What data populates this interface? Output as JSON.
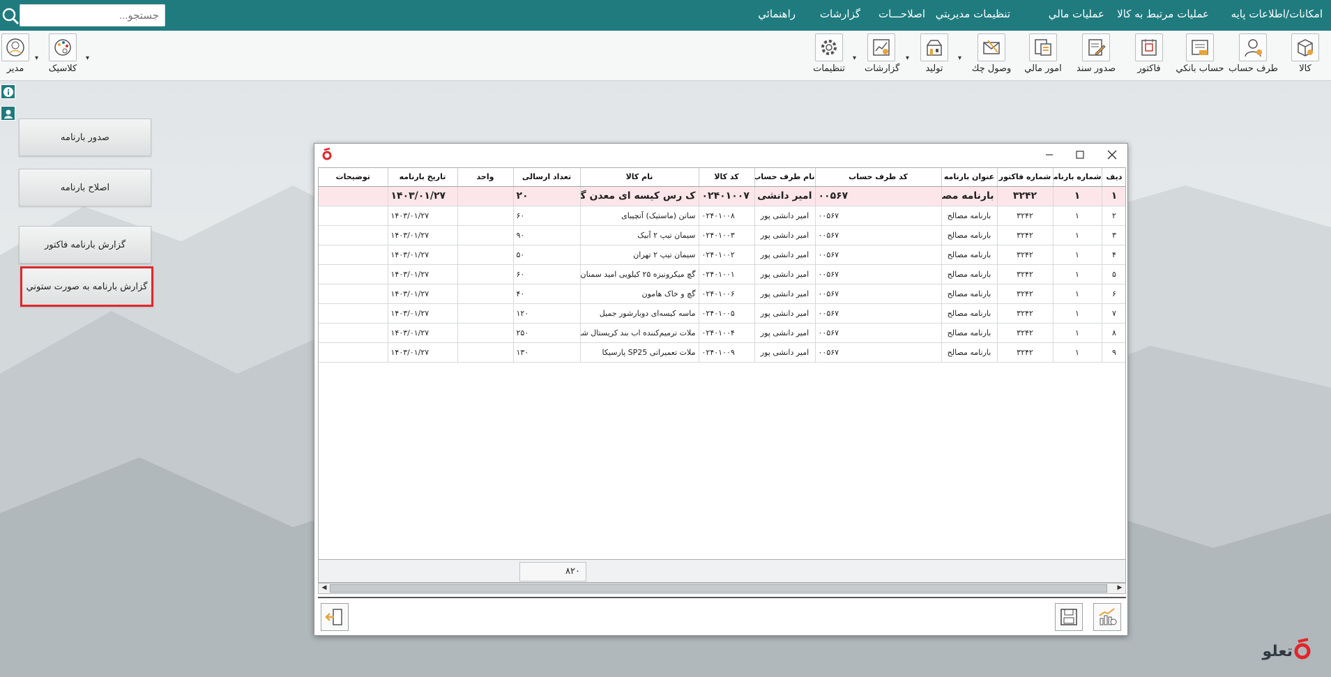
{
  "menu": {
    "items": [
      "امکانات/اطلاعات پايه",
      "عمليات مرتبط به کالا",
      "عمليات مالي",
      "تنظيمات مديريتي",
      "اصلاحـــات",
      "گزارشات",
      "راهنمائي"
    ]
  },
  "search": {
    "placeholder": "جستجو..."
  },
  "toolbar": {
    "items": [
      "کالا",
      "طرف حساب",
      "حساب بانکي",
      "فاکتور",
      "صدور سند",
      "امور مالي",
      "وصول چك",
      "توليد",
      "گزارشات",
      "تنظيمات"
    ],
    "right_items": [
      "کلاسيک",
      "مدير"
    ]
  },
  "left_buttons": [
    "صدور بارنامه",
    "اصلاح بارنامه",
    "گزارش بارنامه فاکتور",
    "گزارش بارنامه به صورت ستوني"
  ],
  "table": {
    "headers": [
      "ديف",
      "شماره بارنامه",
      "شماره فاکتور",
      "عنوان بارنامه",
      "کد طرف حساب",
      "نام طرف حساب",
      "کد کالا",
      "نام کالا",
      "تعداد ارسالی",
      "واحد",
      "تاريخ بارنامه",
      "توضيحات"
    ],
    "rows": [
      [
        "۱",
        "۱",
        "۳۲۴۲",
        "بارنامه مصالح",
        "۰۰۵۶۷",
        "امیر دانشی پور",
        "۰۲۴۰۱۰۰۷",
        "ک رس کیسه ای معدن گودرزی",
        "۲۰",
        "",
        "۱۴۰۳/۰۱/۲۷",
        ""
      ],
      [
        "۲",
        "۱",
        "۳۲۴۲",
        "بارنامه مصالح",
        "۰۰۵۶۷",
        "امیر دانشی پور",
        "۰۲۴۰۱۰۰۸",
        "ساتن (ماستیک) آتچیبای",
        "۶۰",
        "",
        "۱۴۰۳/۰۱/۲۷",
        ""
      ],
      [
        "۳",
        "۱",
        "۳۲۴۲",
        "بارنامه مصالح",
        "۰۰۵۶۷",
        "امیر دانشی پور",
        "۰۲۴۰۱۰۰۳",
        "سیمان تیپ ۲ آبیک",
        "۹۰",
        "",
        "۱۴۰۳/۰۱/۲۷",
        ""
      ],
      [
        "۴",
        "۱",
        "۳۲۴۲",
        "بارنامه مصالح",
        "۰۰۵۶۷",
        "امیر دانشی پور",
        "۰۲۴۰۱۰۰۲",
        "سیمان تیپ ۲ تهران",
        "۵۰",
        "",
        "۱۴۰۳/۰۱/۲۷",
        ""
      ],
      [
        "۵",
        "۱",
        "۳۲۴۲",
        "بارنامه مصالح",
        "۰۰۵۶۷",
        "امیر دانشی پور",
        "۰۲۴۰۱۰۰۱",
        "گچ میکرونیزه ۲۵ کیلویی امید سمنان",
        "۶۰",
        "",
        "۱۴۰۳/۰۱/۲۷",
        ""
      ],
      [
        "۶",
        "۱",
        "۳۲۴۲",
        "بارنامه مصالح",
        "۰۰۵۶۷",
        "امیر دانشی پور",
        "۰۲۴۰۱۰۰۶",
        "گچ و خاک هامون",
        "۴۰",
        "",
        "۱۴۰۳/۰۱/۲۷",
        ""
      ],
      [
        "۷",
        "۱",
        "۳۲۴۲",
        "بارنامه مصالح",
        "۰۰۵۶۷",
        "امیر دانشی پور",
        "۰۲۴۰۱۰۰۵",
        "ماسه کیسه‌ای دوبارشور جمیل",
        "۱۲۰",
        "",
        "۱۴۰۳/۰۱/۲۷",
        ""
      ],
      [
        "۸",
        "۱",
        "۳۲۴۲",
        "بارنامه مصالح",
        "۰۰۵۶۷",
        "امیر دانشی پور",
        "۰۲۴۰۱۰۰۴",
        "ملات ترمیم‌کننده اب بند کریستال شونده",
        "۲۵۰",
        "",
        "۱۴۰۳/۰۱/۲۷",
        ""
      ],
      [
        "۹",
        "۱",
        "۳۲۴۲",
        "بارنامه مصالح",
        "۰۰۵۶۷",
        "امیر دانشی پور",
        "۰۲۴۰۱۰۰۹",
        "ملات تعمیراتی SP25 پارسیکا",
        "۱۳۰",
        "",
        "۱۴۰۳/۰۱/۲۷",
        ""
      ]
    ],
    "total_sent": "۸۲۰"
  },
  "brand": {
    "name": "تعلو"
  },
  "colors": {
    "menubar": "#1f7b7e",
    "selected_border": "#e1262b",
    "first_row_bg": "#fde6ea",
    "logo_red": "#e0262b"
  }
}
